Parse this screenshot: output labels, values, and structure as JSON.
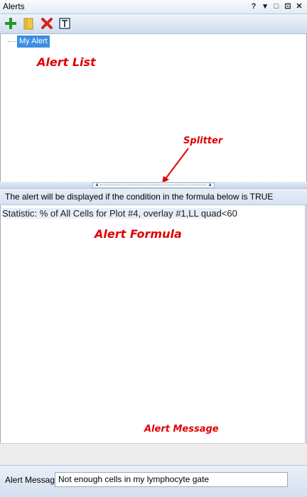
{
  "window": {
    "title": "Alerts",
    "controls": [
      "?",
      "▾",
      "□",
      "⊡",
      "✕"
    ]
  },
  "toolbar": {
    "buttons": [
      {
        "name": "add-alert-button",
        "icon": "plus-icon"
      },
      {
        "name": "open-alert-button",
        "icon": "folder-icon"
      },
      {
        "name": "delete-alert-button",
        "icon": "delete-x-icon"
      },
      {
        "name": "text-alert-button",
        "icon": "text-icon"
      }
    ]
  },
  "alert_list": {
    "items": [
      {
        "label": "My Alert",
        "selected": true
      }
    ]
  },
  "condition_header": "The alert will be displayed if the condition in the formula below is TRUE",
  "formula": {
    "token": "Statistic: % of All Cells for Plot #4, overlay #1,LL quad",
    "operator": "<60"
  },
  "message": {
    "label": "Alert Message",
    "value": "Not enough cells in my lymphocyte gate"
  },
  "annotations": {
    "alert_list": "Alert List",
    "splitter": "Splitter",
    "alert_formula": "Alert Formula",
    "alert_message": "Alert Message"
  },
  "colors": {
    "annotation": "#e00000",
    "selection": "#3b8fe3"
  }
}
